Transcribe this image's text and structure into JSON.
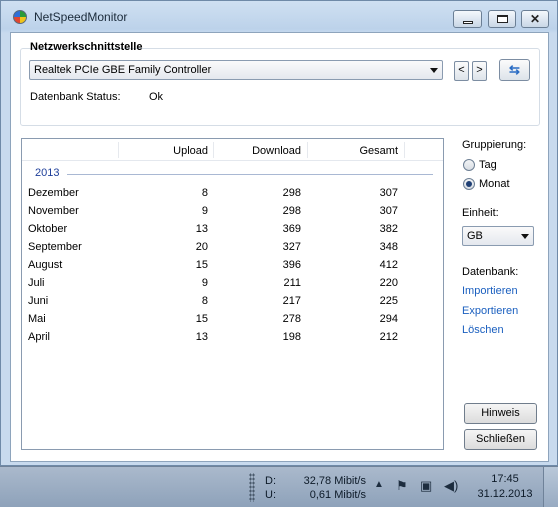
{
  "window": {
    "title": "NetSpeedMonitor"
  },
  "interface": {
    "section_title": "Netzwerkschnittstelle",
    "adapter": "Realtek PCIe GBE Family Controller",
    "prev": "<",
    "next": ">",
    "status_label": "Datenbank Status:",
    "status_value": "Ok"
  },
  "table": {
    "headers": [
      "Upload",
      "Download",
      "Gesamt"
    ],
    "year": "2013",
    "rows": [
      {
        "month": "Dezember",
        "upload": "8",
        "download": "298",
        "total": "307"
      },
      {
        "month": "November",
        "upload": "9",
        "download": "298",
        "total": "307"
      },
      {
        "month": "Oktober",
        "upload": "13",
        "download": "369",
        "total": "382"
      },
      {
        "month": "September",
        "upload": "20",
        "download": "327",
        "total": "348"
      },
      {
        "month": "August",
        "upload": "15",
        "download": "396",
        "total": "412"
      },
      {
        "month": "Juli",
        "upload": "9",
        "download": "211",
        "total": "220"
      },
      {
        "month": "Juni",
        "upload": "8",
        "download": "217",
        "total": "225"
      },
      {
        "month": "Mai",
        "upload": "15",
        "download": "278",
        "total": "294"
      },
      {
        "month": "April",
        "upload": "13",
        "download": "198",
        "total": "212"
      }
    ]
  },
  "grouping": {
    "label": "Gruppierung:",
    "options": [
      "Tag",
      "Monat"
    ],
    "selected": "Monat"
  },
  "unit": {
    "label": "Einheit:",
    "value": "GB"
  },
  "database": {
    "label": "Datenbank:",
    "actions": [
      "Importieren",
      "Exportieren",
      "Löschen"
    ]
  },
  "buttons": {
    "hint": "Hinweis",
    "close": "Schließen"
  },
  "taskbar": {
    "down_label": "D:",
    "down_value": "32,78 Mibit/s",
    "up_label": "U:",
    "up_value": "0,61 Mibit/s",
    "time": "17:45",
    "date": "31.12.2013"
  },
  "icons": [
    "app-icon",
    "minimize-icon",
    "maximize-icon",
    "close-icon",
    "refresh-icon",
    "dropdown-arrow-icon",
    "tray-expand-icon",
    "flag-icon",
    "network-icon",
    "speaker-icon"
  ]
}
